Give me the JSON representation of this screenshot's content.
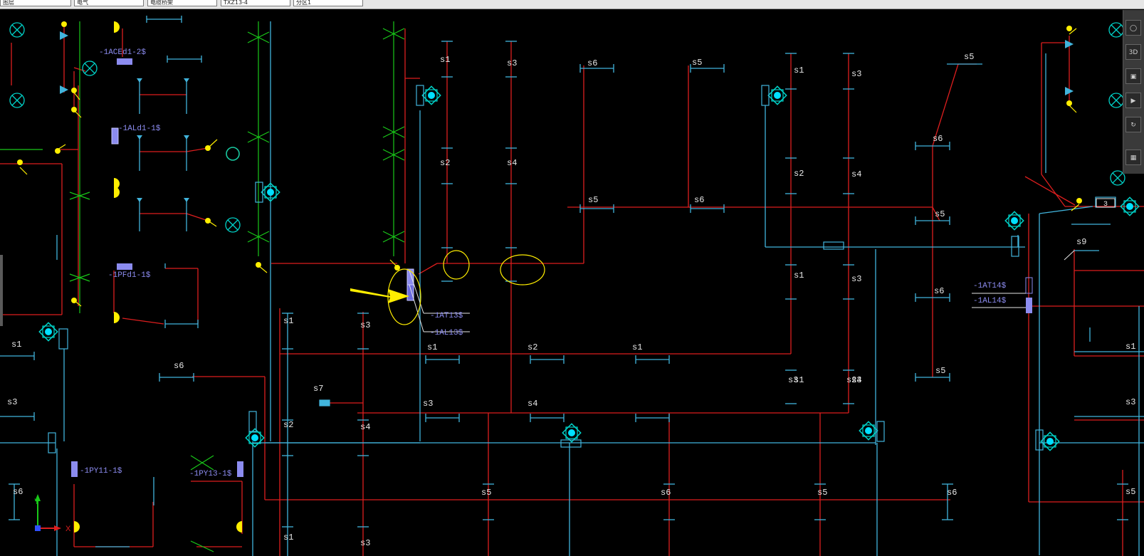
{
  "toolbar": {
    "fields": [
      "图层",
      "电气",
      "电缆桥架",
      "TXZ13-4",
      "分区1"
    ]
  },
  "colors": {
    "background": "#000000",
    "cyan": "#41b4dc",
    "red": "#dc1e1e",
    "green": "#19c819",
    "yellow": "#ffee00",
    "purple": "#8c8cf0",
    "white": "#e6e6e6",
    "teal": "#00d2c8"
  },
  "cad": {
    "tray_labels": [
      "s1",
      "s3",
      "s6",
      "s5",
      "s1",
      "s3",
      "s5",
      "s2",
      "s4",
      "s2",
      "s4",
      "s6",
      "s5",
      "s6",
      "s5",
      "s1",
      "s3",
      "s1",
      "s3",
      "s6",
      "s1",
      "s3",
      "s1",
      "s2",
      "s1",
      "s5",
      "s6",
      "s1",
      "s7",
      "s2",
      "s4",
      "s3",
      "s4",
      "s3",
      "s2",
      "s4",
      "s5",
      "s3",
      "s6",
      "s5",
      "s6",
      "s6",
      "s5",
      "s1",
      "s3",
      "s9",
      "s1",
      "s3"
    ],
    "equipment_labels": [
      "-1ACEd1-2$",
      "-1ALd1-1$",
      "-1PFd1-1$",
      "-1AT13$",
      "-1AL13$",
      "-1PY11-1$",
      "-1PY13-1$",
      "-1AT14$",
      "-1AL14$"
    ],
    "tag_number": "3"
  },
  "ucs": {
    "x_label": "X",
    "y_label": "Y"
  },
  "nav": {
    "items": [
      "orbit-icon",
      "3d-view-icon",
      "pan-icon",
      "zoom-icon",
      "rotate-icon",
      "grid-icon"
    ],
    "labels": [
      "",
      "3D",
      "",
      "",
      "",
      ""
    ]
  }
}
